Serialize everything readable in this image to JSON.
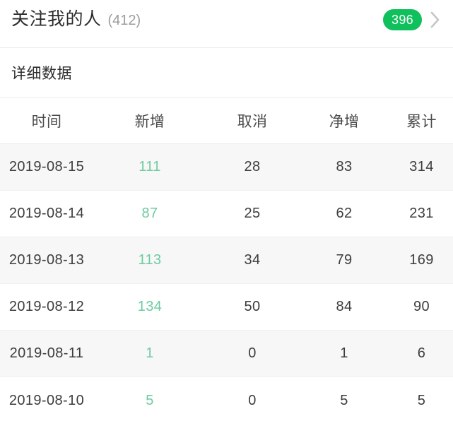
{
  "top_bar": {
    "title": "关注我的人",
    "count_label": "(412)",
    "badge_value": "396",
    "badge_color": "#10c05d",
    "chevron_icon": "chevron-right-icon"
  },
  "section": {
    "heading": "详细数据"
  },
  "table": {
    "columns": [
      "时间",
      "新增",
      "取消",
      "净增",
      "累计"
    ],
    "new_value_color": "#6ecba1",
    "rows": [
      {
        "date": "2019-08-15",
        "new": "111",
        "cancel": "28",
        "net": "83",
        "cumulative": "314"
      },
      {
        "date": "2019-08-14",
        "new": "87",
        "cancel": "25",
        "net": "62",
        "cumulative": "231"
      },
      {
        "date": "2019-08-13",
        "new": "113",
        "cancel": "34",
        "net": "79",
        "cumulative": "169"
      },
      {
        "date": "2019-08-12",
        "new": "134",
        "cancel": "50",
        "net": "84",
        "cumulative": "90"
      },
      {
        "date": "2019-08-11",
        "new": "1",
        "cancel": "0",
        "net": "1",
        "cumulative": "6"
      },
      {
        "date": "2019-08-10",
        "new": "5",
        "cancel": "0",
        "net": "5",
        "cumulative": "5"
      }
    ]
  }
}
